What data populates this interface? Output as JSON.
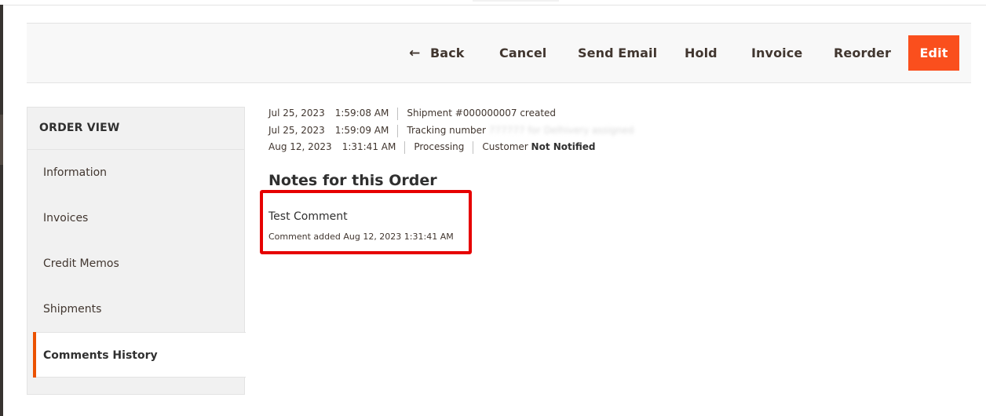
{
  "toolbar": {
    "back_label": "Back",
    "back_icon": "arrow-left-icon",
    "cancel_label": "Cancel",
    "send_email_label": "Send Email",
    "hold_label": "Hold",
    "invoice_label": "Invoice",
    "reorder_label": "Reorder",
    "edit_label": "Edit",
    "accent_color": "#fa4f1d"
  },
  "sidebar": {
    "title": "ORDER VIEW",
    "items": [
      {
        "label": "Information",
        "active": false
      },
      {
        "label": "Invoices",
        "active": false
      },
      {
        "label": "Credit Memos",
        "active": false
      },
      {
        "label": "Shipments",
        "active": false
      },
      {
        "label": "Comments History",
        "active": true
      }
    ],
    "active_color": "#eb5202"
  },
  "history": [
    {
      "date": "Jul 25, 2023",
      "time": "1:59:08 AM",
      "text": "Shipment #000000007 created"
    },
    {
      "date": "Jul 25, 2023",
      "time": "1:59:09 AM",
      "text": "Tracking number",
      "blurred": "777777 for Delhivery assigned"
    },
    {
      "date": "Aug 12, 2023",
      "time": "1:31:41 AM",
      "status": "Processing",
      "notify_prefix": "Customer",
      "notify_value": "Not Notified"
    }
  ],
  "notes": {
    "title": "Notes for this Order",
    "comment": "Test Comment",
    "meta": "Comment added Aug 12, 2023 1:31:41 AM",
    "highlight_color": "#e60000"
  }
}
